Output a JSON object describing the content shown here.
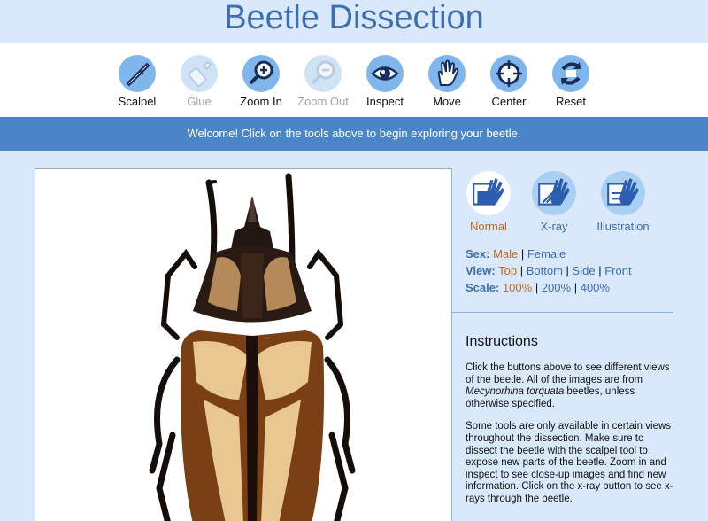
{
  "page": {
    "title": "Beetle Dissection"
  },
  "toolbar": {
    "tools": [
      {
        "label": "Scalpel",
        "icon": "scalpel-icon",
        "enabled": true
      },
      {
        "label": "Glue",
        "icon": "glue-icon",
        "enabled": false
      },
      {
        "label": "Zoom In",
        "icon": "zoom-in-icon",
        "enabled": true
      },
      {
        "label": "Zoom Out",
        "icon": "zoom-out-icon",
        "enabled": false
      },
      {
        "label": "Inspect",
        "icon": "eye-icon",
        "enabled": true
      },
      {
        "label": "Move",
        "icon": "hand-icon",
        "enabled": true
      },
      {
        "label": "Center",
        "icon": "crosshair-icon",
        "enabled": true
      },
      {
        "label": "Reset",
        "icon": "reset-icon",
        "enabled": true
      }
    ]
  },
  "message": "Welcome! Click on the tools above to begin exploring your beetle.",
  "viewer": {
    "image": "beetle-top-view",
    "alt_icon": "beetle-icon"
  },
  "modes": [
    {
      "label": "Normal",
      "icon": "glove-normal-icon",
      "active": true
    },
    {
      "label": "X-ray",
      "icon": "glove-xray-icon",
      "active": false
    },
    {
      "label": "Illustration",
      "icon": "glove-illustration-icon",
      "active": false
    }
  ],
  "options": {
    "sex": {
      "label": "Sex:",
      "values": [
        "Male",
        "Female"
      ],
      "selected": "Male"
    },
    "view": {
      "label": "View:",
      "values": [
        "Top",
        "Bottom",
        "Side",
        "Front"
      ],
      "selected": "Top"
    },
    "scale": {
      "label": "Scale:",
      "values": [
        "100%",
        "200%",
        "400%"
      ],
      "selected": "100%"
    }
  },
  "instructions": {
    "heading": "Instructions",
    "p1_before": "Click the buttons above to see different views of the beetle. All of the images are from ",
    "p1_species": "Mecynorhina torquata",
    "p1_after": " beetles, unless otherwise specified.",
    "p2": "Some tools are only available in certain views throughout the dissection. Make sure to dissect the beetle with the scalpel tool to expose new parts of the beetle. Zoom in and inspect to see close-up images and find new information. Click on the x-ray button to see x-rays through the beetle."
  },
  "colors": {
    "page_bg": "#d9e9fb",
    "title": "#3d6faf",
    "message_bar": "#4a86c7",
    "selected_option": "#c4681c",
    "tool_circle": "#7fb6ec"
  }
}
